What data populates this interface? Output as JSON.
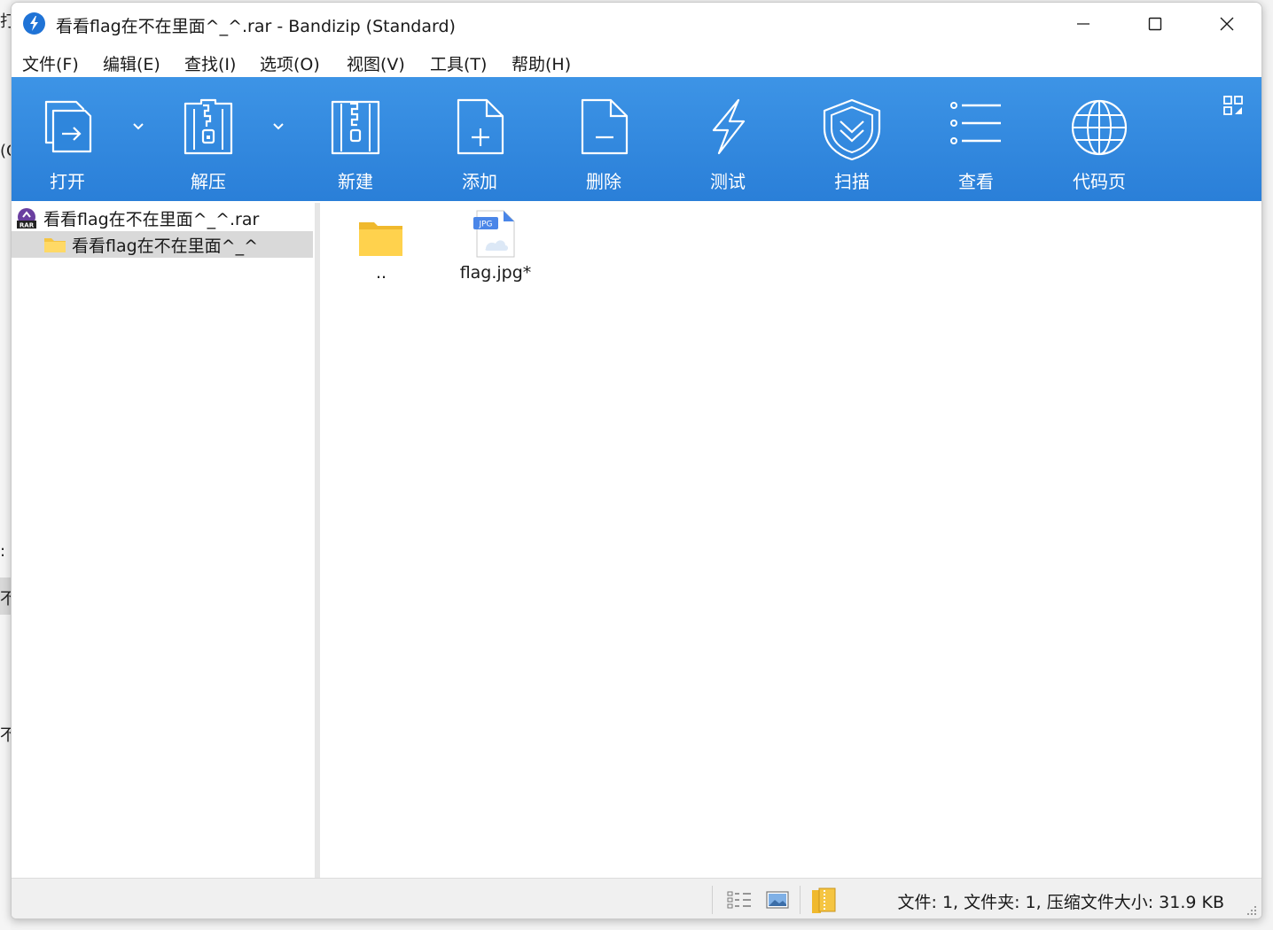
{
  "background": {
    "fragments": [
      "打",
      "(C",
      ":",
      "不",
      "不"
    ]
  },
  "window": {
    "title": "看看flag在不在里面^_^.rar - Bandizip (Standard)"
  },
  "menu": [
    {
      "label": "文件(F)"
    },
    {
      "label": "编辑(E)"
    },
    {
      "label": "查找(I)"
    },
    {
      "label": "选项(O)"
    },
    {
      "label": "视图(V)"
    },
    {
      "label": "工具(T)"
    },
    {
      "label": "帮助(H)"
    }
  ],
  "toolbar": {
    "accent": "#2a7fd8",
    "buttons": [
      {
        "label": "打开",
        "icon": "open-icon"
      },
      {
        "label": "解压",
        "icon": "extract-icon"
      },
      {
        "label": "新建",
        "icon": "new-archive-icon"
      },
      {
        "label": "添加",
        "icon": "add-file-icon"
      },
      {
        "label": "删除",
        "icon": "delete-file-icon"
      },
      {
        "label": "测试",
        "icon": "test-lightning-icon"
      },
      {
        "label": "扫描",
        "icon": "scan-shield-icon"
      },
      {
        "label": "查看",
        "icon": "view-list-icon"
      },
      {
        "label": "代码页",
        "icon": "codepage-globe-icon"
      }
    ]
  },
  "tree": {
    "archive": "看看flag在不在里面^_^.rar",
    "folder": "看看flag在不在里面^_^"
  },
  "files": [
    {
      "name": "..",
      "icon": "folder-icon"
    },
    {
      "name": "flag.jpg*",
      "icon": "jpg-file-icon",
      "badge": "JPG"
    }
  ],
  "status": {
    "text": "文件: 1, 文件夹: 1, 压缩文件大小: 31.9 KB"
  }
}
